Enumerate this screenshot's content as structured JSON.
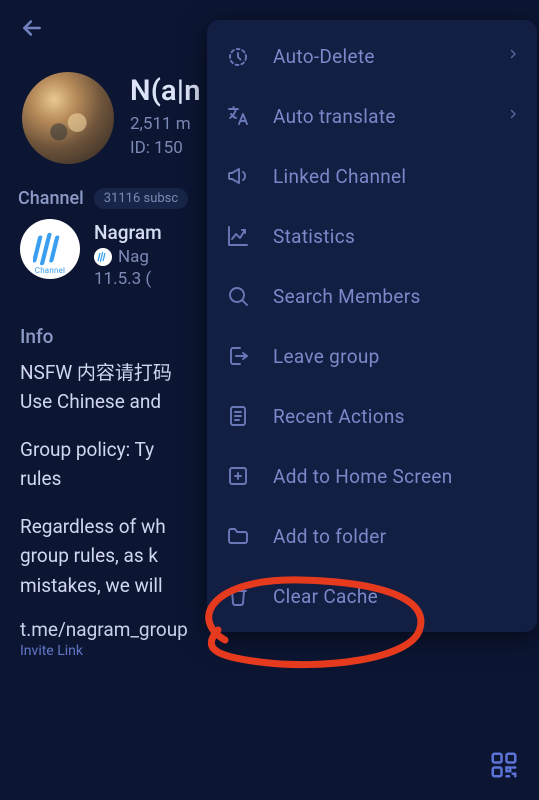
{
  "header": {
    "title": "N(a|n",
    "members": "2,511 m",
    "id_line": "ID: 150"
  },
  "channel": {
    "section_label": "Channel",
    "pill": "31116 subsc",
    "name": "Nagram",
    "sub_prefix": "Nag",
    "version": "11.5.3 (",
    "avatar_caption": "Channel"
  },
  "info": {
    "heading": "Info",
    "p1": "NSFW 内容请打码\nUse Chinese and",
    "p2": "Group policy: Ty\nrules",
    "p3": "Regardless of wh\ngroup rules, as k\nmistakes, we will"
  },
  "invite": {
    "link": "t.me/nagram_group",
    "label": "Invite Link"
  },
  "menu": {
    "items": [
      {
        "label": "Auto-Delete",
        "icon": "timer-icon",
        "chevron": true
      },
      {
        "label": "Auto translate",
        "icon": "translate-icon",
        "chevron": true
      },
      {
        "label": "Linked Channel",
        "icon": "megaphone-icon",
        "chevron": false
      },
      {
        "label": "Statistics",
        "icon": "stats-icon",
        "chevron": false
      },
      {
        "label": "Search Members",
        "icon": "search-icon",
        "chevron": false
      },
      {
        "label": "Leave group",
        "icon": "leave-icon",
        "chevron": false
      },
      {
        "label": "Recent Actions",
        "icon": "recent-icon",
        "chevron": false
      },
      {
        "label": "Add to Home Screen",
        "icon": "add-home-icon",
        "chevron": false
      },
      {
        "label": "Add to folder",
        "icon": "folder-icon",
        "chevron": false
      },
      {
        "label": "Clear Cache",
        "icon": "trash-icon",
        "chevron": false
      }
    ]
  }
}
